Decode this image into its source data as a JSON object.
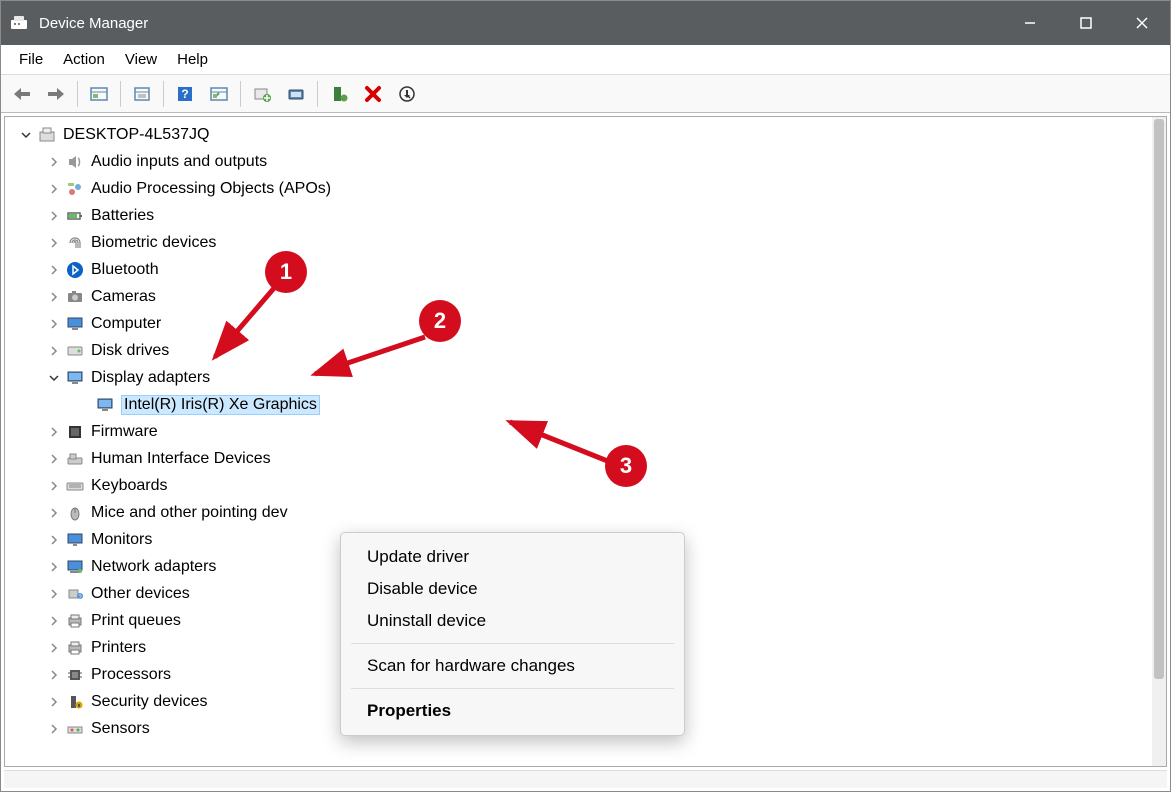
{
  "titlebar": {
    "title": "Device Manager"
  },
  "menu": {
    "items": [
      "File",
      "Action",
      "View",
      "Help"
    ]
  },
  "tree": {
    "root": "DESKTOP-4L537JQ",
    "nodes": [
      {
        "label": "Audio inputs and outputs",
        "icon": "speaker"
      },
      {
        "label": "Audio Processing Objects (APOs)",
        "icon": "apo"
      },
      {
        "label": "Batteries",
        "icon": "battery"
      },
      {
        "label": "Biometric devices",
        "icon": "fingerprint"
      },
      {
        "label": "Bluetooth",
        "icon": "bluetooth"
      },
      {
        "label": "Cameras",
        "icon": "camera"
      },
      {
        "label": "Computer",
        "icon": "computer"
      },
      {
        "label": "Disk drives",
        "icon": "disk"
      },
      {
        "label": "Display adapters",
        "icon": "display",
        "expanded": true,
        "children": [
          {
            "label": "Intel(R) Iris(R) Xe Graphics",
            "icon": "display",
            "selected": true
          }
        ]
      },
      {
        "label": "Firmware",
        "icon": "firmware"
      },
      {
        "label": "Human Interface Devices",
        "icon": "hid"
      },
      {
        "label": "Keyboards",
        "icon": "keyboard"
      },
      {
        "label": "Mice and other pointing dev",
        "icon": "mouse"
      },
      {
        "label": "Monitors",
        "icon": "monitor"
      },
      {
        "label": "Network adapters",
        "icon": "network"
      },
      {
        "label": "Other devices",
        "icon": "other"
      },
      {
        "label": "Print queues",
        "icon": "printer"
      },
      {
        "label": "Printers",
        "icon": "printer"
      },
      {
        "label": "Processors",
        "icon": "cpu"
      },
      {
        "label": "Security devices",
        "icon": "security"
      },
      {
        "label": "Sensors",
        "icon": "sensor"
      }
    ]
  },
  "context_menu": {
    "items": [
      {
        "label": "Update driver"
      },
      {
        "label": "Disable device"
      },
      {
        "label": "Uninstall device"
      },
      {
        "sep": true
      },
      {
        "label": "Scan for hardware changes"
      },
      {
        "sep": true
      },
      {
        "label": "Properties",
        "bold": true
      }
    ]
  },
  "annotations": {
    "b1": "1",
    "b2": "2",
    "b3": "3"
  }
}
